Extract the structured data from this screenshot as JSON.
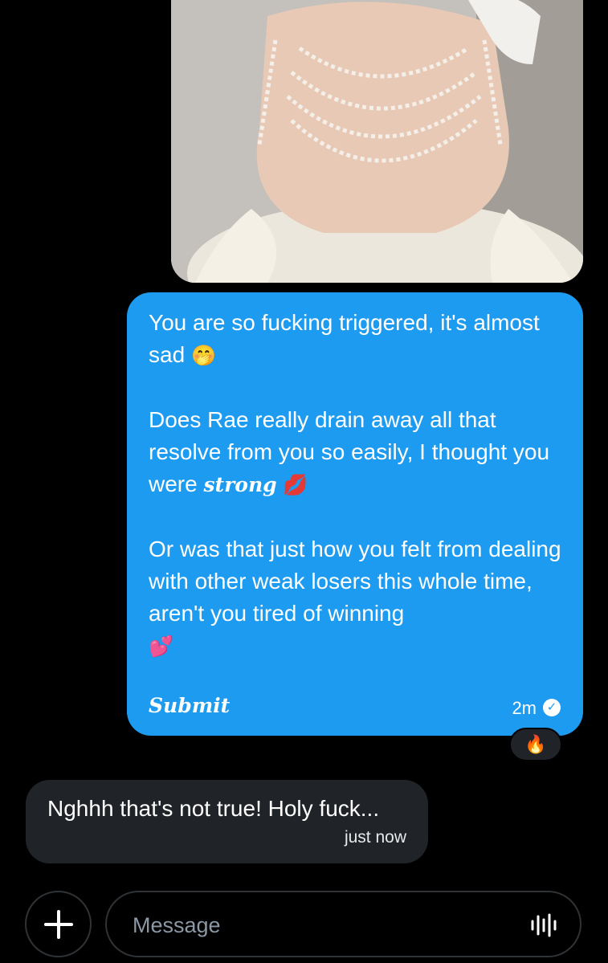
{
  "chat": {
    "outgoing": {
      "paragraphs": [
        {
          "text": "You are so fucking triggered, it's almost sad",
          "emoji": "🤭"
        },
        {
          "text": "Does Rae really drain away all that resolve from you so easily, I thought you were ",
          "styled_word": "𝒔𝒕𝒓𝒐𝒏𝒈",
          "emoji": "💋"
        },
        {
          "text": "Or was that just how you felt from dealing with other weak losers this whole time, aren't you tired of winning",
          "emoji": "💕"
        }
      ],
      "signoff": "𝑺𝒖𝒃𝒎𝒊𝒕",
      "time": "2m",
      "reaction": "🔥"
    },
    "incoming": {
      "text": "Nghhh that's not true! Holy fuck...",
      "time": "just now"
    }
  },
  "composer": {
    "placeholder": "Message",
    "plus_icon": "plus-icon",
    "voice_icon": "voice-wave-icon"
  },
  "colors": {
    "outgoing_bubble": "#1d9bf0",
    "incoming_bubble": "#202327",
    "background": "#000000"
  }
}
